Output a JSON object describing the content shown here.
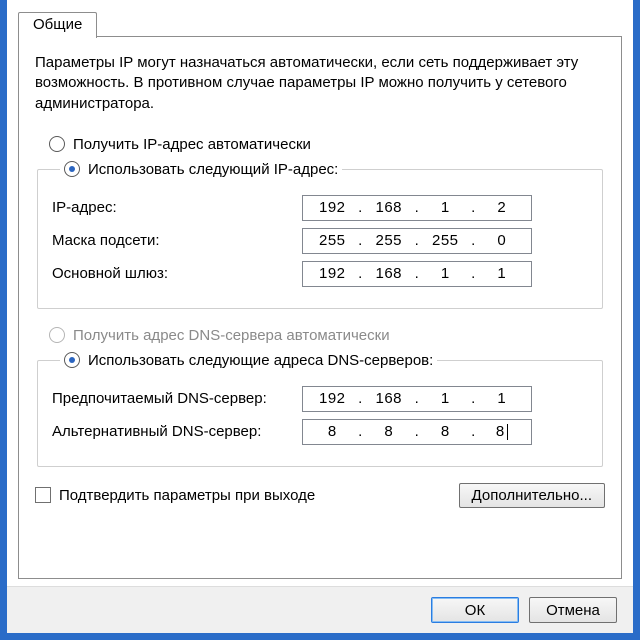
{
  "tab": {
    "label": "Общие"
  },
  "description": "Параметры IP могут назначаться автоматически, если сеть поддерживает эту возможность. В противном случае параметры IP можно получить у сетевого администратора.",
  "ip_section": {
    "auto_label": "Получить IP-адрес автоматически",
    "manual_label": "Использовать следующий IP-адрес:",
    "fields": {
      "ip": {
        "label": "IP-адрес:",
        "o1": "192",
        "o2": "168",
        "o3": "1",
        "o4": "2"
      },
      "mask": {
        "label": "Маска подсети:",
        "o1": "255",
        "o2": "255",
        "o3": "255",
        "o4": "0"
      },
      "gateway": {
        "label": "Основной шлюз:",
        "o1": "192",
        "o2": "168",
        "o3": "1",
        "o4": "1"
      }
    }
  },
  "dns_section": {
    "auto_label": "Получить адрес DNS-сервера автоматически",
    "manual_label": "Использовать следующие адреса DNS-серверов:",
    "fields": {
      "preferred": {
        "label": "Предпочитаемый DNS-сервер:",
        "o1": "192",
        "o2": "168",
        "o3": "1",
        "o4": "1"
      },
      "alternate": {
        "label": "Альтернативный DNS-сервер:",
        "o1": "8",
        "o2": "8",
        "o3": "8",
        "o4": "8"
      }
    }
  },
  "validate_label": "Подтвердить параметры при выходе",
  "advanced_label": "Дополнительно...",
  "ok_label": "ОК",
  "cancel_label": "Отмена"
}
